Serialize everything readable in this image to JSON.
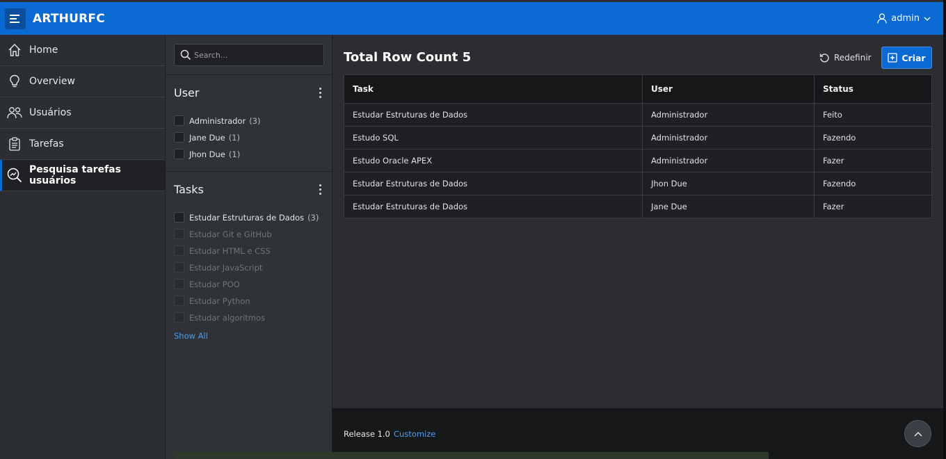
{
  "header": {
    "app_title": "ARTHURFC",
    "user_name": "admin"
  },
  "sidebar": {
    "items": [
      {
        "label": "Home",
        "icon": "home-icon"
      },
      {
        "label": "Overview",
        "icon": "lightbulb-icon"
      },
      {
        "label": "Usuários",
        "icon": "users-icon"
      },
      {
        "label": "Tarefas",
        "icon": "clipboard-icon"
      },
      {
        "label": "Pesquisa tarefas usuários",
        "icon": "search-chart-icon",
        "active": true
      }
    ]
  },
  "facets": {
    "search_placeholder": "Search...",
    "user": {
      "title": "User",
      "options": [
        {
          "label": "Administrador",
          "count": "(3)"
        },
        {
          "label": "Jane Due",
          "count": "(1)"
        },
        {
          "label": "Jhon Due",
          "count": "(1)"
        }
      ]
    },
    "tasks": {
      "title": "Tasks",
      "options": [
        {
          "label": "Estudar Estruturas de Dados",
          "count": "(3)"
        },
        {
          "label": "Estudar Git e GitHub"
        },
        {
          "label": "Estudar HTML e CSS"
        },
        {
          "label": "Estudar JavaScript"
        },
        {
          "label": "Estudar POO"
        },
        {
          "label": "Estudar Python"
        },
        {
          "label": "Estudar algoritmos"
        }
      ],
      "show_all": "Show All"
    }
  },
  "main": {
    "row_count_title": "Total Row Count 5",
    "reset_label": "Redefinir",
    "create_label": "Criar",
    "table": {
      "headers": [
        "Task",
        "User",
        "Status"
      ],
      "rows": [
        [
          "Estudar Estruturas de Dados",
          "Administrador",
          "Feito"
        ],
        [
          "Estudo SQL",
          "Administrador",
          "Fazendo"
        ],
        [
          "Estudo Oracle APEX",
          "Administrador",
          "Fazer"
        ],
        [
          "Estudar Estruturas de Dados",
          "Jhon Due",
          "Fazendo"
        ],
        [
          "Estudar Estruturas de Dados",
          "Jane Due",
          "Fazer"
        ]
      ]
    }
  },
  "footer": {
    "release": "Release 1.0",
    "customize": "Customize"
  },
  "colors": {
    "accent": "#0b69d3",
    "link": "#4a9cf0"
  }
}
